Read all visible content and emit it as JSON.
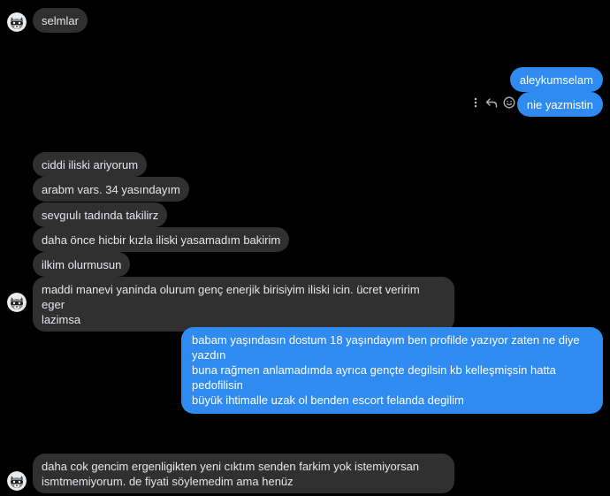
{
  "conversation": {
    "incoming_1": "selmlar",
    "outgoing_1": "aleykumselam",
    "outgoing_2": "nie yazmistin",
    "incoming_2": "ciddi iliski ariyorum",
    "incoming_3": "arabm vars. 34 yasındayım",
    "incoming_4": "sevgıulı tadında takilirz",
    "incoming_5": "daha önce hicbir kızla iliski yasamadım bakirim",
    "incoming_6": "ilkim olurmusun",
    "incoming_7_line1": "maddi manevi yaninda olurum genç enerjik birisiyim iliski icin. ücret veririm eger",
    "incoming_7_line2": "lazimsa",
    "outgoing_3_line1": "babam yaşındasın dostum 18 yaşındayım ben profilde yazıyor zaten ne diye yazdın",
    "outgoing_3_line2": "buna rağmen anlamadımda ayrıca gençte degilsin kb kelleşmişsin hatta pedofilisin",
    "outgoing_3_line3": "büyük ihtimalle uzak ol benden escort felanda degilim",
    "incoming_8_line1": "daha cok gencim ergenligikten yeni cıktım senden farkim yok istemiyorsan",
    "incoming_8_line2": "ismtmemiyorum. de fiyati söylemedim ama henüz"
  },
  "icons": {
    "more": "more-vertical-icon",
    "reply": "reply-icon",
    "react": "smiley-icon",
    "avatar": "raccoon-avatar"
  },
  "colors": {
    "background": "#000000",
    "incoming_bubble": "#303030",
    "outgoing_bubble": "#2f8bef",
    "text": "#e4e6eb"
  }
}
